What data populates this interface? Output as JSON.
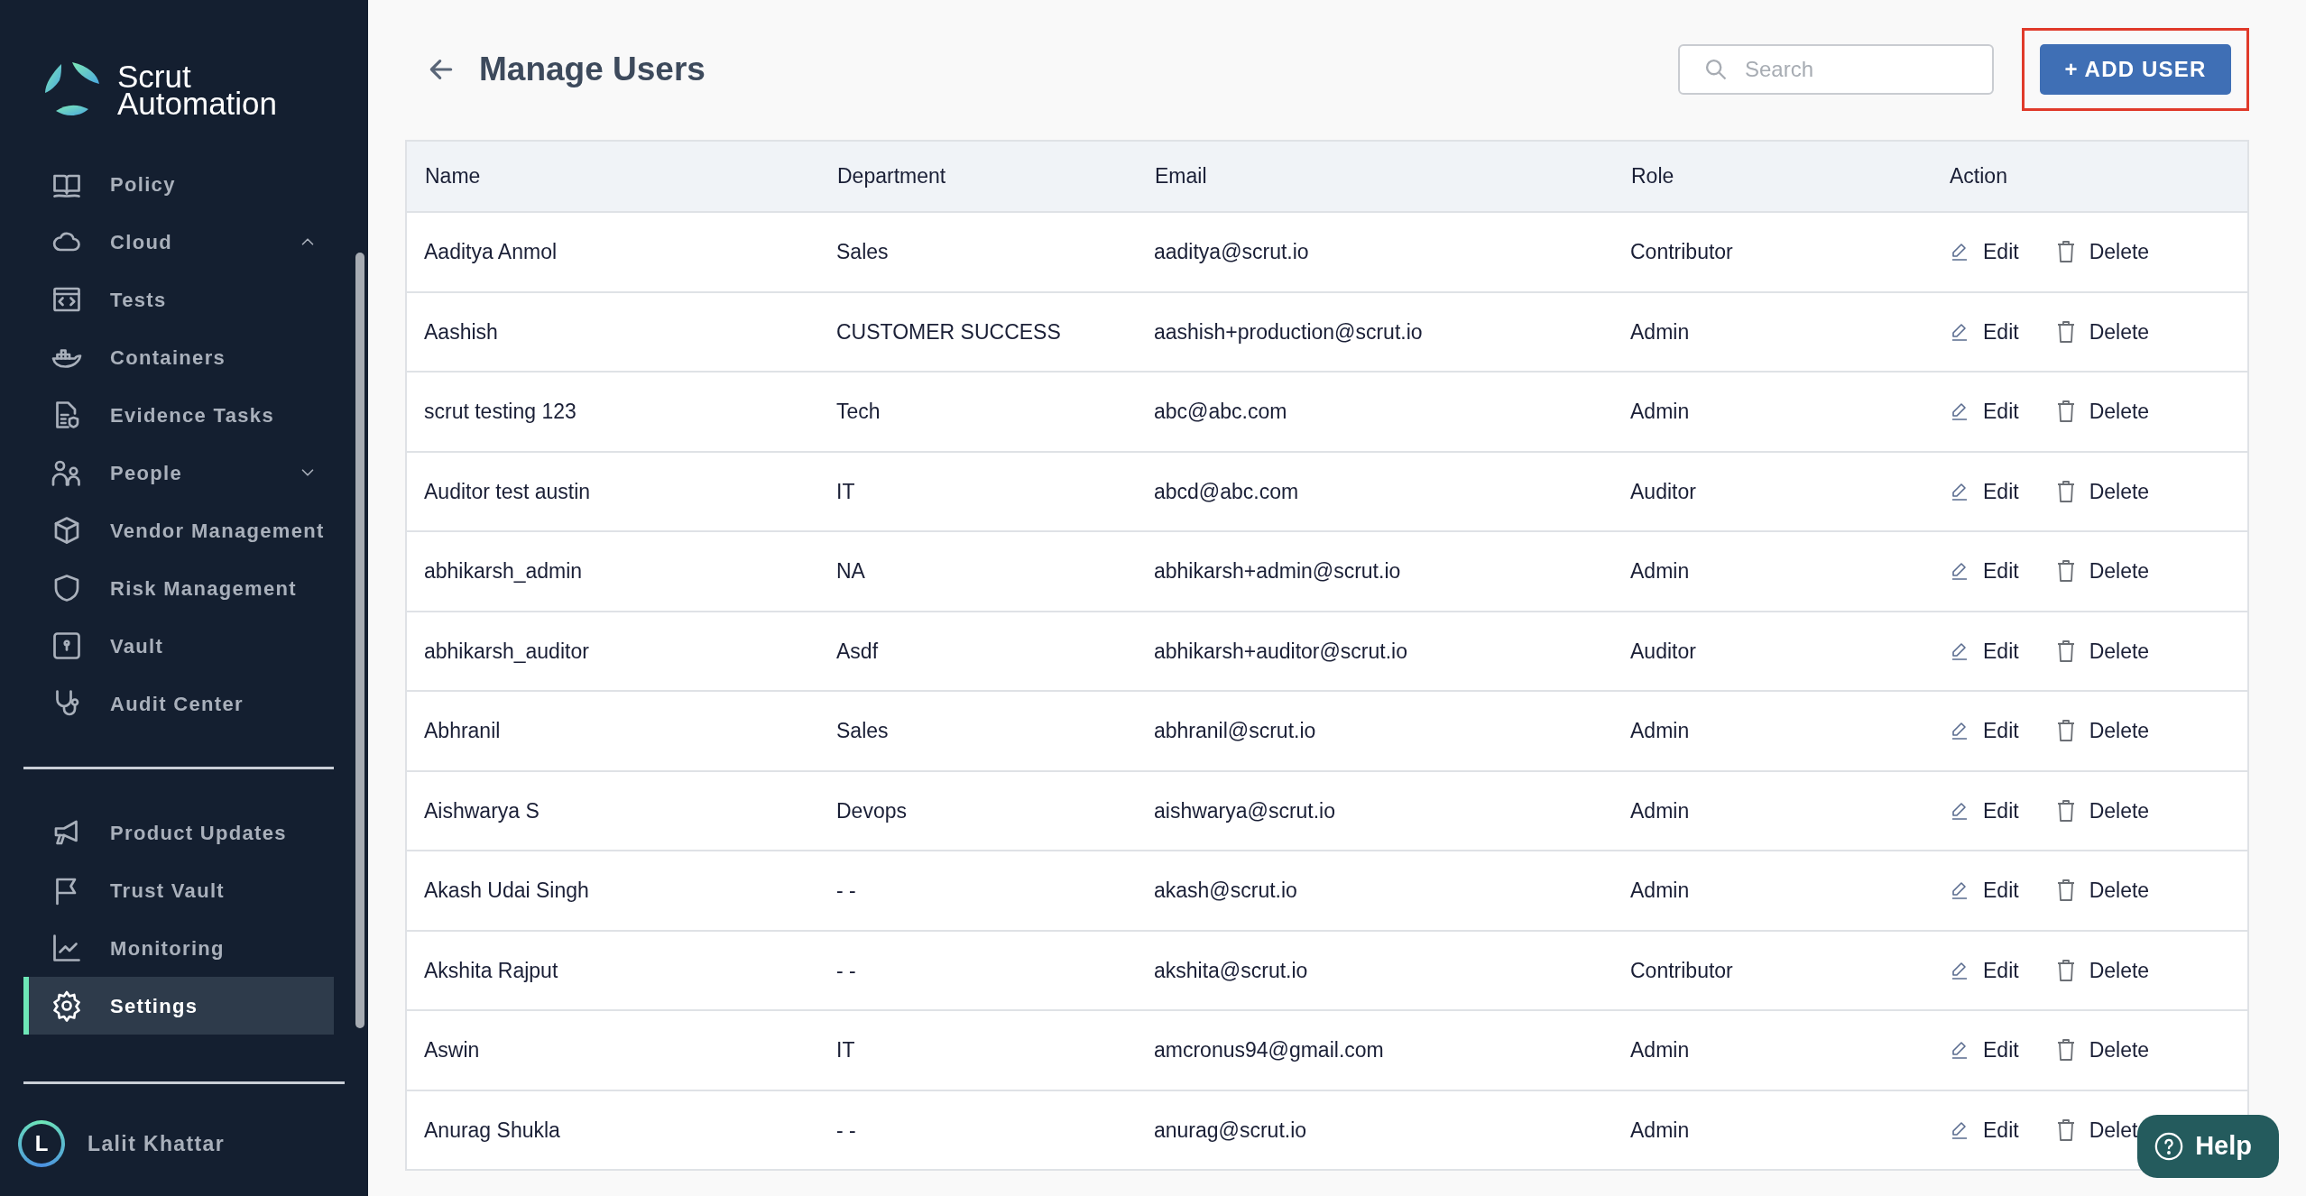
{
  "brand": {
    "line1": "Scrut",
    "line2": "Automation"
  },
  "sidebar": {
    "items": [
      {
        "label": "Policy",
        "selected": false
      },
      {
        "label": "Cloud",
        "selected": false,
        "expanded": true,
        "children": [
          {
            "label": "Tests",
            "selected": false
          },
          {
            "label": "Containers",
            "selected": false
          }
        ]
      },
      {
        "label": "Evidence Tasks",
        "selected": false
      },
      {
        "label": "People",
        "selected": false,
        "expanded": false
      },
      {
        "label": "Vendor Management",
        "selected": false
      },
      {
        "label": "Risk Management",
        "selected": false
      },
      {
        "label": "Vault",
        "selected": false
      },
      {
        "label": "Audit Center",
        "selected": false
      }
    ],
    "bottom_items": [
      {
        "label": "Product Updates",
        "selected": false
      },
      {
        "label": "Trust Vault",
        "selected": false
      },
      {
        "label": "Monitoring",
        "selected": false
      },
      {
        "label": "Settings",
        "selected": true
      }
    ],
    "user": {
      "initial": "L",
      "name": "Lalit Khattar"
    }
  },
  "page": {
    "title": "Manage Users",
    "search": {
      "placeholder": "Search"
    },
    "add_button": "+ ADD USER"
  },
  "table": {
    "columns": [
      "Name",
      "Department",
      "Email",
      "Role",
      "Action"
    ],
    "rows": [
      {
        "name": "Aaditya Anmol",
        "department": "Sales",
        "email": "aaditya@scrut.io",
        "role": "Contributor",
        "actions": [
          "Edit",
          "Delete"
        ]
      },
      {
        "name": "Aashish",
        "department": "CUSTOMER SUCCESS",
        "email": "aashish+production@scrut.io",
        "role": "Admin",
        "actions": [
          "Edit",
          "Delete"
        ]
      },
      {
        "name": "scrut testing 123",
        "department": "Tech",
        "email": "abc@abc.com",
        "role": "Admin",
        "actions": [
          "Edit",
          "Delete"
        ]
      },
      {
        "name": "Auditor test austin",
        "department": "IT",
        "email": "abcd@abc.com",
        "role": "Auditor",
        "actions": [
          "Edit",
          "Delete"
        ]
      },
      {
        "name": "abhikarsh_admin",
        "department": "NA",
        "email": "abhikarsh+admin@scrut.io",
        "role": "Admin",
        "actions": [
          "Edit",
          "Delete"
        ]
      },
      {
        "name": "abhikarsh_auditor",
        "department": "Asdf",
        "email": "abhikarsh+auditor@scrut.io",
        "role": "Auditor",
        "actions": [
          "Edit",
          "Delete"
        ]
      },
      {
        "name": "Abhranil",
        "department": "Sales",
        "email": "abhranil@scrut.io",
        "role": "Admin",
        "actions": [
          "Edit",
          "Delete"
        ]
      },
      {
        "name": "Aishwarya S",
        "department": "Devops",
        "email": "aishwarya@scrut.io",
        "role": "Admin",
        "actions": [
          "Edit",
          "Delete"
        ]
      },
      {
        "name": "Akash Udai Singh",
        "department": "- -",
        "email": "akash@scrut.io",
        "role": "Admin",
        "actions": [
          "Edit",
          "Delete"
        ]
      },
      {
        "name": "Akshita Rajput",
        "department": "- -",
        "email": "akshita@scrut.io",
        "role": "Contributor",
        "actions": [
          "Edit",
          "Delete"
        ]
      },
      {
        "name": "Aswin",
        "department": "IT",
        "email": "amcronus94@gmail.com",
        "role": "Admin",
        "actions": [
          "Edit",
          "Delete"
        ]
      },
      {
        "name": "Anurag Shukla",
        "department": "- -",
        "email": "anurag@scrut.io",
        "role": "Admin",
        "actions": [
          "Edit",
          "Delet"
        ]
      }
    ]
  },
  "help_button": "Help"
}
